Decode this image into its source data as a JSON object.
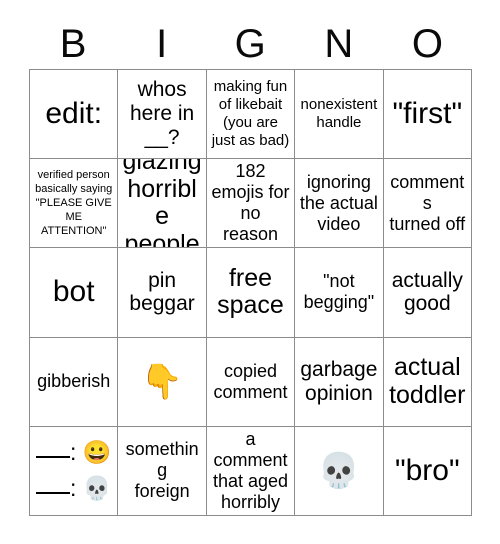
{
  "card": {
    "type": "bingo-card",
    "header_letters": [
      "B",
      "I",
      "G",
      "N",
      "O"
    ],
    "columns": 5,
    "rows": 5,
    "colors": {
      "background": "#ffffff",
      "text": "#000000",
      "grid_line": "#8c8c8c"
    },
    "cells": [
      {
        "id": "b1",
        "text": "edit:",
        "size": "fs-xxl",
        "kind": "text"
      },
      {
        "id": "i1",
        "text": "whos\nhere in\n__?",
        "size": "fs-lg",
        "kind": "text"
      },
      {
        "id": "g1",
        "text": "making fun\nof likebait\n(you are\njust as bad)",
        "size": "fs-sm",
        "kind": "text"
      },
      {
        "id": "n1",
        "text": "nonexistent\nhandle",
        "size": "fs-sm",
        "kind": "text"
      },
      {
        "id": "o1",
        "text": "\"first\"",
        "size": "fs-xxl",
        "kind": "text"
      },
      {
        "id": "b2",
        "text": "verified person\nbasically saying\n\"PLEASE GIVE\nME\nATTENTION\"",
        "size": "fs-xs",
        "kind": "text"
      },
      {
        "id": "i2",
        "text": "glazing\nhorrible\npeople",
        "size": "fs-xl",
        "kind": "text"
      },
      {
        "id": "g2",
        "text": "182\nemojis for\nno reason",
        "size": "fs-md",
        "kind": "text"
      },
      {
        "id": "n2",
        "text": "ignoring\nthe actual\nvideo",
        "size": "fs-md",
        "kind": "text"
      },
      {
        "id": "o2",
        "text": "comments\nturned off",
        "size": "fs-md",
        "kind": "text"
      },
      {
        "id": "b3",
        "text": "bot",
        "size": "fs-xxl",
        "kind": "text"
      },
      {
        "id": "i3",
        "text": "pin\nbeggar",
        "size": "fs-lg",
        "kind": "text"
      },
      {
        "id": "g3",
        "text": "free\nspace",
        "size": "fs-xl",
        "kind": "text"
      },
      {
        "id": "n3",
        "text": "\"not\nbegging\"",
        "size": "fs-md",
        "kind": "text"
      },
      {
        "id": "o3",
        "text": "actually\ngood",
        "size": "fs-lg",
        "kind": "text"
      },
      {
        "id": "b4",
        "text": "gibberish",
        "size": "fs-md",
        "kind": "text"
      },
      {
        "id": "i4",
        "text": "👇",
        "size": "fs-md",
        "kind": "emoji",
        "emoji_name": "backhand-index-pointing-down"
      },
      {
        "id": "g4",
        "text": "copied\ncomment",
        "size": "fs-md",
        "kind": "text"
      },
      {
        "id": "n4",
        "text": "garbage\nopinion",
        "size": "fs-lg",
        "kind": "text"
      },
      {
        "id": "o4",
        "text": "actual\ntoddler",
        "size": "fs-xl",
        "kind": "text"
      },
      {
        "id": "b5",
        "text": "___: 😀\n___: 💀",
        "size": "fs-md",
        "kind": "emoji-lines",
        "emoji_name": "grinning-face-and-skull"
      },
      {
        "id": "i5",
        "text": "something\nforeign",
        "size": "fs-md",
        "kind": "text"
      },
      {
        "id": "g5",
        "text": "a\ncomment\nthat aged\nhorribly",
        "size": "fs-md",
        "kind": "text"
      },
      {
        "id": "n5",
        "text": "💀",
        "size": "fs-md",
        "kind": "emoji",
        "emoji_name": "skull"
      },
      {
        "id": "o5",
        "text": "\"bro\"",
        "size": "fs-xxl",
        "kind": "text"
      }
    ]
  }
}
